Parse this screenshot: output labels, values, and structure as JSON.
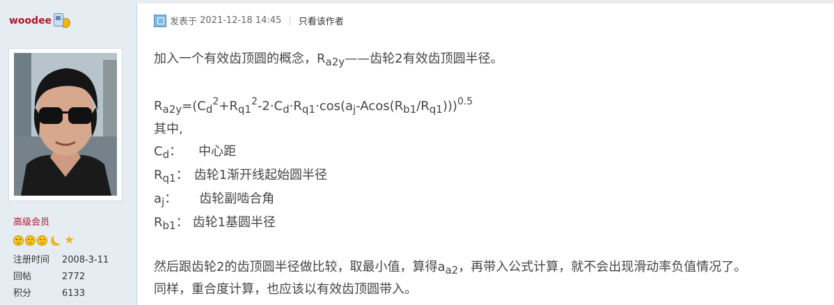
{
  "sidebar": {
    "author": "woodee",
    "group": "高级会员",
    "stats": [
      {
        "label": "注册时间",
        "value": "2008-3-11"
      },
      {
        "label": "回帖",
        "value": "2772"
      },
      {
        "label": "积分",
        "value": "6133"
      }
    ],
    "icons": [
      "phone-badge-icon",
      "medal-badge-icon",
      "sun-icon",
      "moon-icon",
      "star-icon"
    ]
  },
  "post": {
    "meta_prefix": "发表于",
    "datetime": "2021-12-18 14:45",
    "sep": "|",
    "only_author": "只看该作者",
    "intro": {
      "a": "加入一个有效齿顶圆的概念，R",
      "sub": "a2y",
      "b": "——齿轮2有效齿顶圆半径。"
    },
    "formula": {
      "t1": "R",
      "s1": "a2y",
      "t2": "=(C",
      "s2": "d",
      "p1": "2",
      "t3": "+R",
      "s3": "q1",
      "p2": "2",
      "t4": "-2·C",
      "s4": "d",
      "t5": "·R",
      "s5": "q1",
      "t6": "·cos(a",
      "s6": "j",
      "t7": "-Acos(R",
      "s7": "b1",
      "t8": "/R",
      "s8": "q1",
      "t9": ")))",
      "p3": "0.5"
    },
    "where": "其中,",
    "defs": [
      {
        "sym": "C",
        "sub": "d",
        "sep": "：",
        "desc": "中心距"
      },
      {
        "sym": "R",
        "sub": "q1",
        "sep": "：",
        "desc": "齿轮1渐开线起始圆半径"
      },
      {
        "sym": "a",
        "sub": "j",
        "sep": "：",
        "desc": "齿轮副啮合角"
      },
      {
        "sym": "R",
        "sub": "b1",
        "sep": "：",
        "desc": "齿轮1基圆半径"
      }
    ],
    "p2": {
      "a": "然后跟齿轮2的齿顶圆半径做比较，取最小值，算得a",
      "sub": "a2",
      "b": "，再带入公式计算，就不会出现滑动率负值情况了。"
    },
    "p3": "同样，重合度计算，也应该以有效齿顶圆带入。"
  },
  "colors": {
    "sidebar_bg": "#e5edf2",
    "author": "#b5132b",
    "text": "#444444"
  }
}
